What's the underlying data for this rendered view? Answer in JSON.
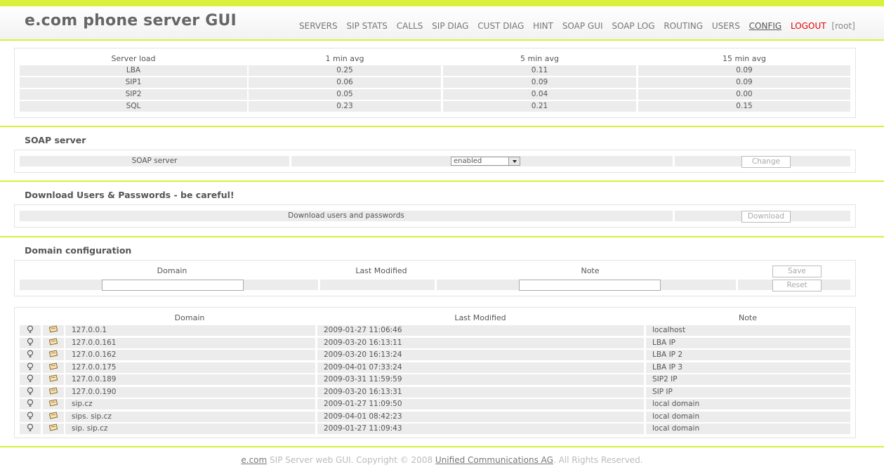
{
  "header": {
    "title": "e.com phone server GUI",
    "nav": [
      "SERVERS",
      "SIP STATS",
      "CALLS",
      "SIP DIAG",
      "CUST DIAG",
      "HINT",
      "SOAP GUI",
      "SOAP LOG",
      "ROUTING",
      "USERS",
      "CONFIG"
    ],
    "active": "CONFIG",
    "logout": "LOGOUT",
    "user": "[root]"
  },
  "server_load": {
    "headers": [
      "Server load",
      "1 min avg",
      "5 min avg",
      "15 min avg"
    ],
    "rows": [
      [
        "LBA",
        "0.25",
        "0.11",
        "0.09"
      ],
      [
        "SIP1",
        "0.06",
        "0.09",
        "0.09"
      ],
      [
        "SIP2",
        "0.05",
        "0.04",
        "0.00"
      ],
      [
        "SQL",
        "0.23",
        "0.21",
        "0.15"
      ]
    ]
  },
  "soap": {
    "title": "SOAP server",
    "label": "SOAP server",
    "selected": "enabled",
    "button": "Change"
  },
  "download": {
    "title": "Download Users & Passwords - be careful!",
    "label": "Download users and passwords",
    "button": "Download"
  },
  "domain_config": {
    "title": "Domain configuration",
    "headers": [
      "Domain",
      "Last Modified",
      "Note"
    ],
    "save": "Save",
    "reset": "Reset",
    "domain_value": "",
    "note_value": ""
  },
  "domain_list": {
    "headers": [
      "Domain",
      "Last Modified",
      "Note"
    ],
    "rows": [
      [
        "127.0.0.1",
        "2009-01-27 11:06:46",
        "localhost"
      ],
      [
        "127.0.0.161",
        "2009-03-20 16:13:11",
        "LBA IP"
      ],
      [
        "127.0.0.162",
        "2009-03-20 16:13:24",
        "LBA IP 2"
      ],
      [
        "127.0.0.175",
        "2009-04-01 07:33:24",
        "LBA IP 3"
      ],
      [
        "127.0.0.189",
        "2009-03-31 11:59:59",
        "SIP2 IP"
      ],
      [
        "127.0.0.190",
        "2009-03-20 16:13:31",
        "SIP IP"
      ],
      [
        "sip.cz",
        "2009-01-27 11:09:50",
        "local domain"
      ],
      [
        "sips. sip.cz",
        "2009-04-01 08:42:23",
        "local domain"
      ],
      [
        "sip. sip.cz",
        "2009-01-27 11:09:43",
        "local domain"
      ]
    ],
    "icon_names": [
      "bulb-icon",
      "edit-icon"
    ]
  },
  "footer": {
    "link1": "e.com",
    "text1": " SIP Server web GUI. Copyright © 2008 ",
    "link2": "Unified Communications AG",
    "text2": ". All Rights Reserved."
  }
}
